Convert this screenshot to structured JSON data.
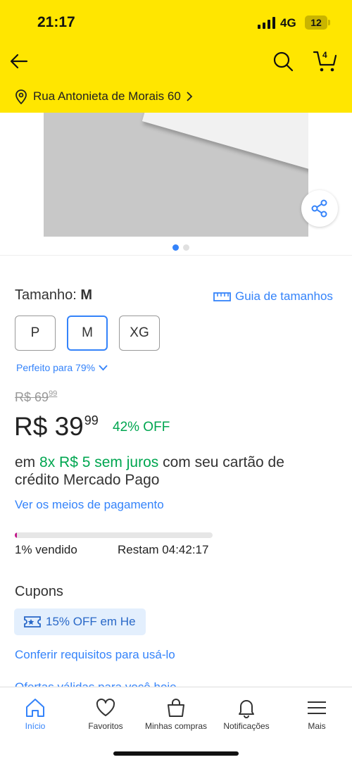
{
  "status_bar": {
    "time": "21:17",
    "network": "4G",
    "battery": "12"
  },
  "header": {
    "back_icon": "arrow-left-icon",
    "search_icon": "search-icon",
    "cart_icon": "cart-icon",
    "cart_count": "4",
    "address": "Rua Antonieta de Morais 60"
  },
  "gallery": {
    "current_image": 1,
    "image_count": 2,
    "share_icon": "share-icon"
  },
  "size": {
    "label": "Tamanho:",
    "selected": "M",
    "guide_label": "Guia de tamanhos",
    "options": [
      "P",
      "M",
      "XG"
    ],
    "fit_label": "Perfeito para 79%"
  },
  "price": {
    "old_currency": "R$",
    "old_int": "69",
    "old_cents": "99",
    "currency": "R$",
    "int": "39",
    "cents": "99",
    "discount": "42% OFF"
  },
  "installments": {
    "prefix": "em",
    "highlight": "8x R$ 5 sem juros",
    "suffix": "com seu cartão de crédito Mercado Pago"
  },
  "payment_link": "Ver os meios de pagamento",
  "stock": {
    "sold_label": "1% vendido",
    "sold_fraction": 0.01,
    "remaining_label": "Restam 04:42:17"
  },
  "coupons": {
    "title": "Cupons",
    "chip_label": "15% OFF em He",
    "requirements_link": "Conferir requisitos para usá-lo",
    "cut_line": "Ofertas válidas para você hoje"
  },
  "tabs": [
    {
      "label": "Início",
      "icon": "home-icon",
      "active": true
    },
    {
      "label": "Favoritos",
      "icon": "heart-icon"
    },
    {
      "label": "Minhas compras",
      "icon": "shopping-bag-icon"
    },
    {
      "label": "Notificações",
      "icon": "bell-icon"
    },
    {
      "label": "Mais",
      "icon": "menu-icon"
    }
  ],
  "colors": {
    "brand_yellow": "#ffe600",
    "accent_blue": "#3483fa",
    "discount_green": "#00a650",
    "progress_fill": "#c2168a"
  }
}
